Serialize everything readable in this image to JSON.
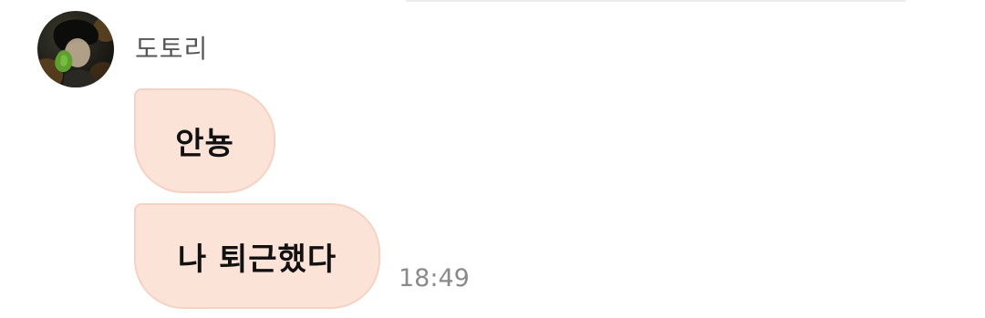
{
  "chat": {
    "sender_name": "도토리",
    "messages": [
      {
        "text": "안뇽"
      },
      {
        "text": "나 퇴근했다"
      }
    ],
    "timestamp": "18:49"
  },
  "icons": {
    "avatar": "profile-photo"
  },
  "colors": {
    "bubble_background": "#fbe3d8",
    "bubble_border": "#f6d2c2",
    "sender_name": "#555555",
    "timestamp": "#8a8a8a"
  }
}
